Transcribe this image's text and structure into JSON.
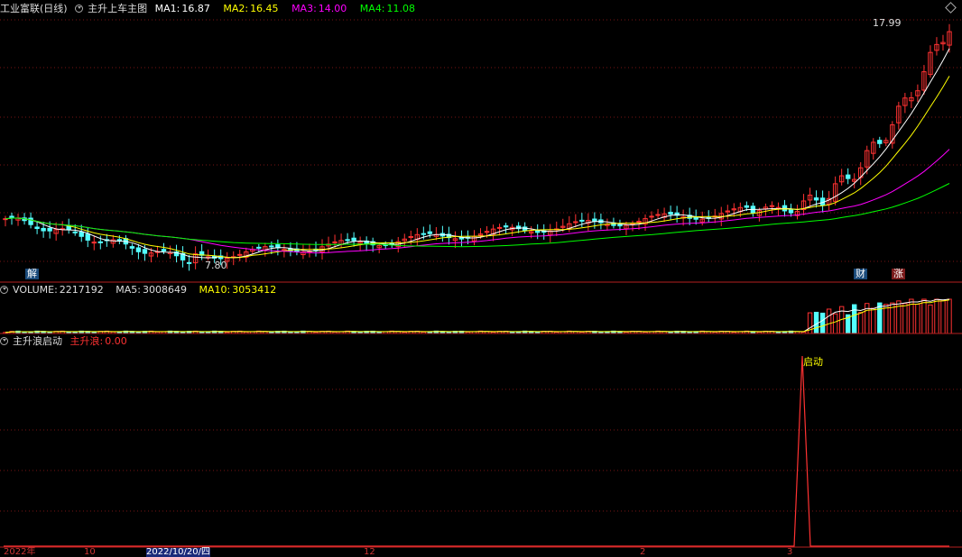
{
  "window": {
    "stock_name": "工业富联",
    "period": "(日线)",
    "indicator_main": "主升上车主图"
  },
  "main_panel": {
    "ma": [
      {
        "label": "MA1:",
        "value": "16.87",
        "color": "#ffffff"
      },
      {
        "label": "MA2:",
        "value": "16.45",
        "color": "#ffff00"
      },
      {
        "label": "MA3:",
        "value": "14.00",
        "color": "#ff00ff"
      },
      {
        "label": "MA4:",
        "value": "11.08",
        "color": "#00ff00"
      }
    ],
    "high_label": "17.99",
    "low_label": "7.80",
    "tags": [
      "解",
      "财",
      "涨"
    ]
  },
  "volume_panel": {
    "label": "VOLUME:",
    "value": "2217192",
    "ma5_label": "MA5:",
    "ma5_value": "3008649",
    "ma10_label": "MA10:",
    "ma10_value": "3053412"
  },
  "signal_panel": {
    "title": "主升浪启动",
    "series_label": "主升浪:",
    "series_value": "0.00",
    "signal_text": "启动"
  },
  "x_axis": {
    "labels": [
      "2022年",
      "10",
      "2022/10/20/四",
      "12",
      "2",
      "3"
    ]
  },
  "colors": {
    "up": "#ff3232",
    "down": "#54ffff",
    "grid": "#781414",
    "background": "#000000"
  },
  "chart_data": {
    "type": "line",
    "ylim": [
      7.8,
      17.99
    ],
    "ma_closing": {
      "MA1": 16.87,
      "MA2": 16.45,
      "MA3": 14.0,
      "MA4": 11.08
    },
    "signal_peak": 1,
    "signal_value": 0.0
  }
}
